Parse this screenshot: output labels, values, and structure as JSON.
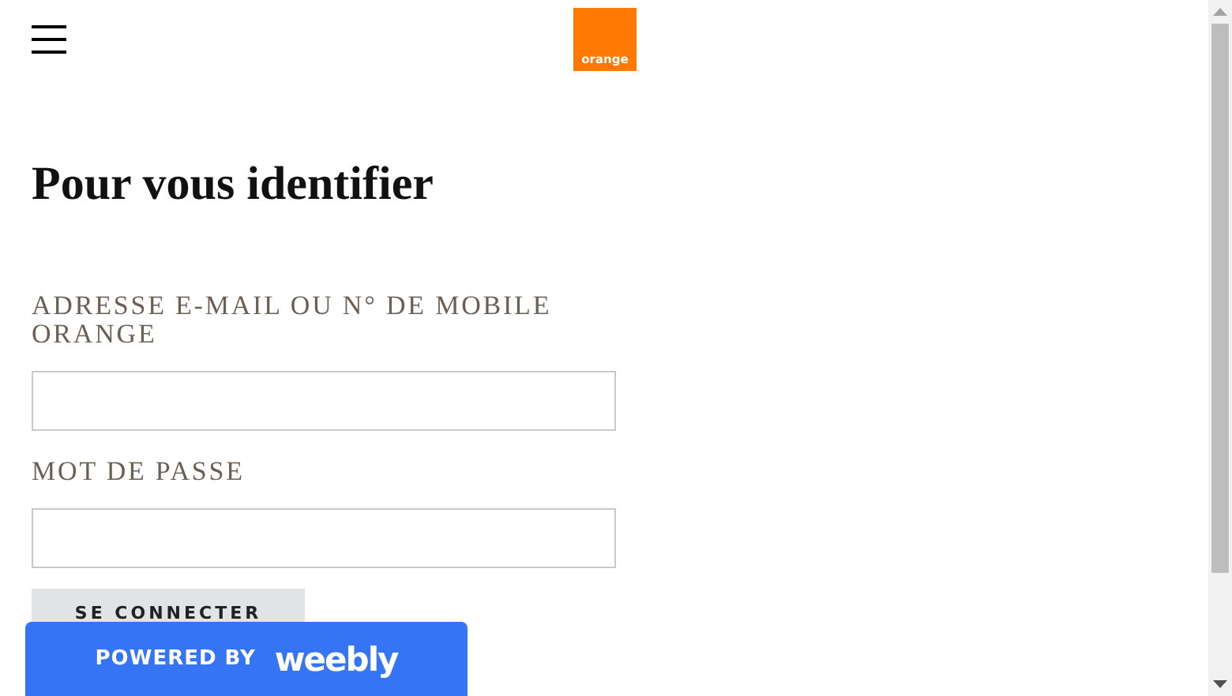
{
  "header": {
    "logo_text": "orange"
  },
  "title": "Pour vous identifier",
  "fields": [
    {
      "label": "ADRESSE E-MAIL OU N° DE MOBILE ORANGE"
    },
    {
      "label": "MOT DE PASSE"
    }
  ],
  "submit_button": "SE CONNECTER",
  "badge": {
    "prefix": "POWERED BY",
    "brand": "weebly"
  }
}
